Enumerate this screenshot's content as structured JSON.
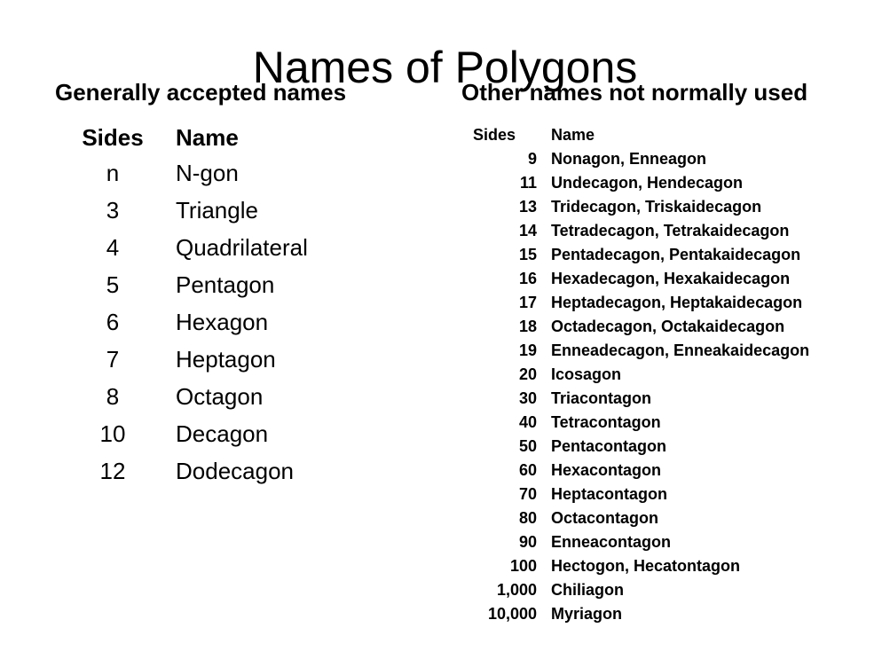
{
  "title": "Names of Polygons",
  "colors": {
    "background": "#ffffff",
    "text": "#000000"
  },
  "left_panel": {
    "heading": "Generally accepted names",
    "columns": [
      "Sides",
      "Name"
    ],
    "rows": [
      {
        "sides": "n",
        "name": "N-gon"
      },
      {
        "sides": "3",
        "name": "Triangle"
      },
      {
        "sides": "4",
        "name": "Quadrilateral"
      },
      {
        "sides": "5",
        "name": "Pentagon"
      },
      {
        "sides": "6",
        "name": "Hexagon"
      },
      {
        "sides": "7",
        "name": "Heptagon"
      },
      {
        "sides": "8",
        "name": "Octagon"
      },
      {
        "sides": "10",
        "name": "Decagon"
      },
      {
        "sides": "12",
        "name": "Dodecagon"
      }
    ]
  },
  "right_panel": {
    "heading": "Other names not normally used",
    "columns": [
      "Sides",
      "Name"
    ],
    "rows": [
      {
        "sides": "9",
        "name": "Nonagon, Enneagon"
      },
      {
        "sides": "11",
        "name": "Undecagon, Hendecagon"
      },
      {
        "sides": "13",
        "name": "Tridecagon, Triskaidecagon"
      },
      {
        "sides": "14",
        "name": "Tetradecagon, Tetrakaidecagon"
      },
      {
        "sides": "15",
        "name": "Pentadecagon, Pentakaidecagon"
      },
      {
        "sides": "16",
        "name": "Hexadecagon, Hexakaidecagon"
      },
      {
        "sides": "17",
        "name": "Heptadecagon, Heptakaidecagon"
      },
      {
        "sides": "18",
        "name": "Octadecagon, Octakaidecagon"
      },
      {
        "sides": "19",
        "name": "Enneadecagon, Enneakaidecagon"
      },
      {
        "sides": "20",
        "name": "Icosagon"
      },
      {
        "sides": "30",
        "name": "Triacontagon"
      },
      {
        "sides": "40",
        "name": "Tetracontagon"
      },
      {
        "sides": "50",
        "name": "Pentacontagon"
      },
      {
        "sides": "60",
        "name": "Hexacontagon"
      },
      {
        "sides": "70",
        "name": "Heptacontagon"
      },
      {
        "sides": "80",
        "name": "Octacontagon"
      },
      {
        "sides": "90",
        "name": "Enneacontagon"
      },
      {
        "sides": "100",
        "name": "Hectogon, Hecatontagon"
      },
      {
        "sides": "1,000",
        "name": "Chiliagon"
      },
      {
        "sides": "10,000",
        "name": "Myriagon"
      }
    ]
  }
}
